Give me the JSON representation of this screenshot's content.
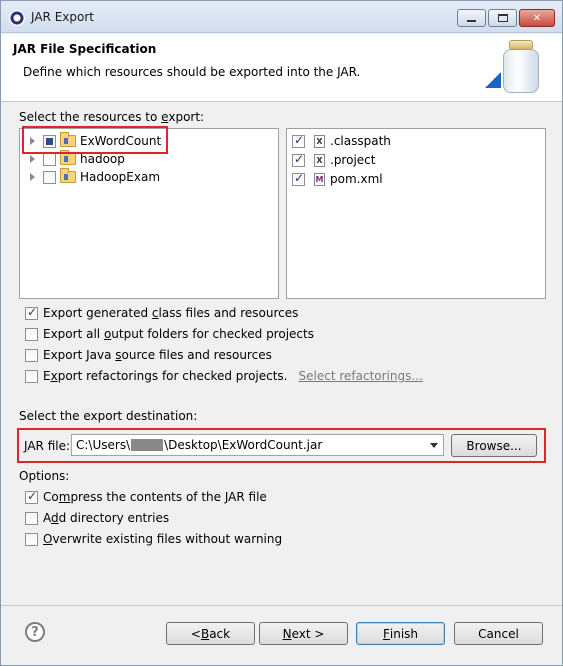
{
  "window": {
    "title": "JAR Export"
  },
  "header": {
    "title": "JAR File Specification",
    "description": "Define which resources should be exported into the JAR."
  },
  "resources": {
    "label_pre": "Select the resources to ",
    "label_acc": "e",
    "label_post": "xport:",
    "projects": [
      {
        "label": "ExWordCount",
        "state": "partial"
      },
      {
        "label": "hadoop",
        "state": "unchecked"
      },
      {
        "label": "HadoopExam",
        "state": "unchecked"
      }
    ],
    "files": [
      {
        "label": ".classpath",
        "icon": "X",
        "checked": true
      },
      {
        "label": ".project",
        "icon": "X",
        "checked": true
      },
      {
        "label": "pom.xml",
        "icon": "M",
        "checked": true
      }
    ]
  },
  "options_top": [
    {
      "pre": "Export generated ",
      "acc": "c",
      "post": "lass files and resources",
      "checked": true,
      "link": ""
    },
    {
      "pre": "Export all ",
      "acc": "o",
      "post": "utput folders for checked projects",
      "checked": false,
      "link": ""
    },
    {
      "pre": "Export Java ",
      "acc": "s",
      "post": "ource files and resources",
      "checked": false,
      "link": ""
    },
    {
      "pre": "E",
      "acc": "x",
      "post": "port refactorings for checked projects.",
      "checked": false,
      "link": "Select refactorings..."
    }
  ],
  "destination": {
    "label": "Select the export destination:",
    "jar_label_acc": "J",
    "jar_label_post": "AR file:",
    "path_prefix": "C:\\Users\\",
    "path_suffix": "\\Desktop\\ExWordCount.jar",
    "browse_label": "Browse..."
  },
  "options": {
    "label": "Options:",
    "items": [
      {
        "pre": "Co",
        "acc": "m",
        "post": "press the contents of the JAR file",
        "checked": true
      },
      {
        "pre": "A",
        "acc": "d",
        "post": "d directory entries",
        "checked": false
      },
      {
        "pre": "",
        "acc": "O",
        "post": "verwrite existing files without warning",
        "checked": false
      }
    ]
  },
  "buttons": {
    "help": "?",
    "back_pre": "< ",
    "back_acc": "B",
    "back_post": "ack",
    "next_acc": "N",
    "next_post": "ext >",
    "finish_acc": "F",
    "finish_post": "inish",
    "cancel": "Cancel"
  },
  "colors": {
    "highlight": "#e0242c",
    "accent": "#1e63c4"
  }
}
